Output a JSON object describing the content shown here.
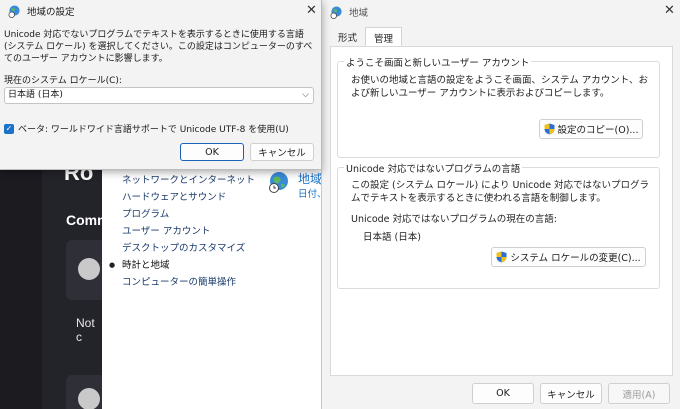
{
  "small_dialog": {
    "title": "地域の設定",
    "close_glyph": "✕",
    "description": "Unicode 対応でないプログラムでテキストを表示するときに使用する言語 (システム ロケール) を選択してください。この設定はコンピューターのすべてのユーザー アカウントに影響します。",
    "locale_label": "現在のシステム ロケール(C):",
    "locale_value": "日本語 (日本)",
    "beta_checkbox_label": "ベータ: ワールドワイド言語サポートで Unicode UTF-8 を使用(U)",
    "beta_checked": true,
    "ok_label": "OK",
    "cancel_label": "キャンセル"
  },
  "region_dialog": {
    "title": "地域",
    "close_glyph": "✕",
    "tabs": [
      {
        "label": "形式",
        "active": false
      },
      {
        "label": "管理",
        "active": true
      }
    ],
    "welcome_group": {
      "label": "ようこそ画面と新しいユーザー アカウント",
      "description": "お使いの地域と言語の設定をようこそ画面、システム アカウント、および新しいユーザー アカウントに表示およびコピーします。",
      "button_label": "設定のコピー(O)..."
    },
    "unicode_group": {
      "label": "Unicode 対応ではないプログラムの言語",
      "description": "この設定 (システム ロケール) により Unicode 対応ではないプログラムでテキストを表示するときに使われる言語を制御します。",
      "current_label": "Unicode 対応ではないプログラムの現在の言語:",
      "current_value": "日本語 (日本)",
      "button_label": "システム ロケールの変更(C)..."
    },
    "footer": {
      "ok_label": "OK",
      "cancel_label": "キャンセル",
      "apply_label": "適用(A)"
    }
  },
  "control_panel": {
    "items": [
      {
        "label": "ネットワークとインターネット",
        "active": false
      },
      {
        "label": "ハードウェアとサウンド",
        "active": false
      },
      {
        "label": "プログラム",
        "active": false
      },
      {
        "label": "ユーザー アカウント",
        "active": false
      },
      {
        "label": "デスクトップのカスタマイズ",
        "active": false
      },
      {
        "label": "時計と地域",
        "active": true
      },
      {
        "label": "コンピューターの簡単操作",
        "active": false
      }
    ],
    "category_title": "地域",
    "category_sub": "日付、"
  },
  "background_app": {
    "heading_fragment": "Ro",
    "comments_fragment": "Comm",
    "text_fragment": "Not c"
  },
  "colors": {
    "accent": "#1a73c8",
    "link": "#1a3a6b",
    "dialog_bg": "#f3f3f3"
  },
  "icons": {
    "titlebar": "globe-clock-icon",
    "buttons": "uac-shield-icon",
    "select": "chevron-down-icon"
  }
}
